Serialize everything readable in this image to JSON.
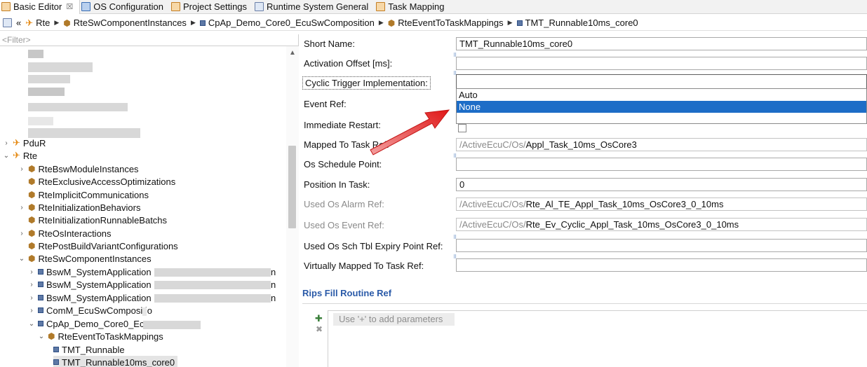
{
  "tabs": [
    {
      "label": "Basic Editor",
      "close": "☒",
      "active": true
    },
    {
      "label": "OS Configuration"
    },
    {
      "label": "Project Settings"
    },
    {
      "label": "Runtime System General"
    },
    {
      "label": "Task Mapping"
    }
  ],
  "breadcrumb": {
    "lead": "«",
    "items": [
      "Rte",
      "RteSwComponentInstances",
      "CpAp_Demo_Core0_EcuSwComposition",
      "RteEventToTaskMappings",
      "TMT_Runnable10ms_core0"
    ]
  },
  "tree": {
    "filter_placeholder": "<Filter>",
    "nodes": [
      {
        "label": "PduR",
        "toggle": "›"
      },
      {
        "label": "Rte",
        "toggle": "⌄"
      },
      {
        "label": "RteBswModuleInstances",
        "toggle": "›"
      },
      {
        "label": "RteExclusiveAccessOptimizations",
        "toggle": ""
      },
      {
        "label": "RteImplicitCommunications",
        "toggle": ""
      },
      {
        "label": "RteInitializationBehaviors",
        "toggle": "›"
      },
      {
        "label": "RteInitializationRunnableBatchs",
        "toggle": ""
      },
      {
        "label": "RteOsInteractions",
        "toggle": "›"
      },
      {
        "label": "RtePostBuildVariantConfigurations",
        "toggle": ""
      },
      {
        "label": "RteSwComponentInstances",
        "toggle": "⌄"
      },
      {
        "label": "BswM_SystemApplication",
        "toggle": "›",
        "suffix": "n"
      },
      {
        "label": "BswM_SystemApplication",
        "toggle": "›",
        "suffix": "n"
      },
      {
        "label": "BswM_SystemApplication",
        "toggle": "›",
        "suffix": "n"
      },
      {
        "label": "ComM_EcuSwCompositio",
        "toggle": "›"
      },
      {
        "label": "CpAp_Demo_Core0_EcuS",
        "toggle": "⌄"
      },
      {
        "label": "RteEventToTaskMappings",
        "toggle": "⌄"
      },
      {
        "label": "TMT_Runnable",
        "toggle": ""
      },
      {
        "label": "TMT_Runnable10ms_core0",
        "toggle": "",
        "selected": true
      }
    ]
  },
  "form": {
    "short_name": {
      "label": "Short Name:",
      "value": "TMT_Runnable10ms_core0"
    },
    "activation_offset": {
      "label": "Activation Offset [ms]:",
      "value": ""
    },
    "cyclic_trigger": {
      "label": "Cyclic Trigger Implementation:",
      "value": "",
      "options": [
        "Auto",
        "None"
      ],
      "selected": "None"
    },
    "event_ref": {
      "label": "Event Ref:"
    },
    "immediate_restart": {
      "label": "Immediate Restart:",
      "checked": false
    },
    "mapped_to_task_ref": {
      "label": "Mapped To Task Ref:",
      "prefix": "/ActiveEcuC/Os/",
      "value": "Appl_Task_10ms_OsCore3"
    },
    "os_schedule_point": {
      "label": "Os Schedule Point:",
      "value": ""
    },
    "position_in_task": {
      "label": "Position In Task:",
      "value": "0"
    },
    "used_os_alarm_ref": {
      "label": "Used Os Alarm Ref:",
      "prefix": "/ActiveEcuC/Os/",
      "value": "Rte_Al_TE_Appl_Task_10ms_OsCore3_0_10ms"
    },
    "used_os_event_ref": {
      "label": "Used Os Event Ref:",
      "prefix": "/ActiveEcuC/Os/",
      "value": "Rte_Ev_Cyclic_Appl_Task_10ms_OsCore3_0_10ms"
    },
    "used_os_sch_tbl": {
      "label": "Used Os Sch Tbl Expiry Point Ref:",
      "value": ""
    },
    "virtually_mapped": {
      "label": "Virtually Mapped To Task Ref:",
      "value": ""
    },
    "rips_section": {
      "title": "Rips Fill Routine Ref",
      "placeholder": "Use '+' to add parameters"
    }
  },
  "colors": {
    "accent": "#1d6dc7",
    "link": "#2a5aa8",
    "arrow": "#e02020"
  }
}
